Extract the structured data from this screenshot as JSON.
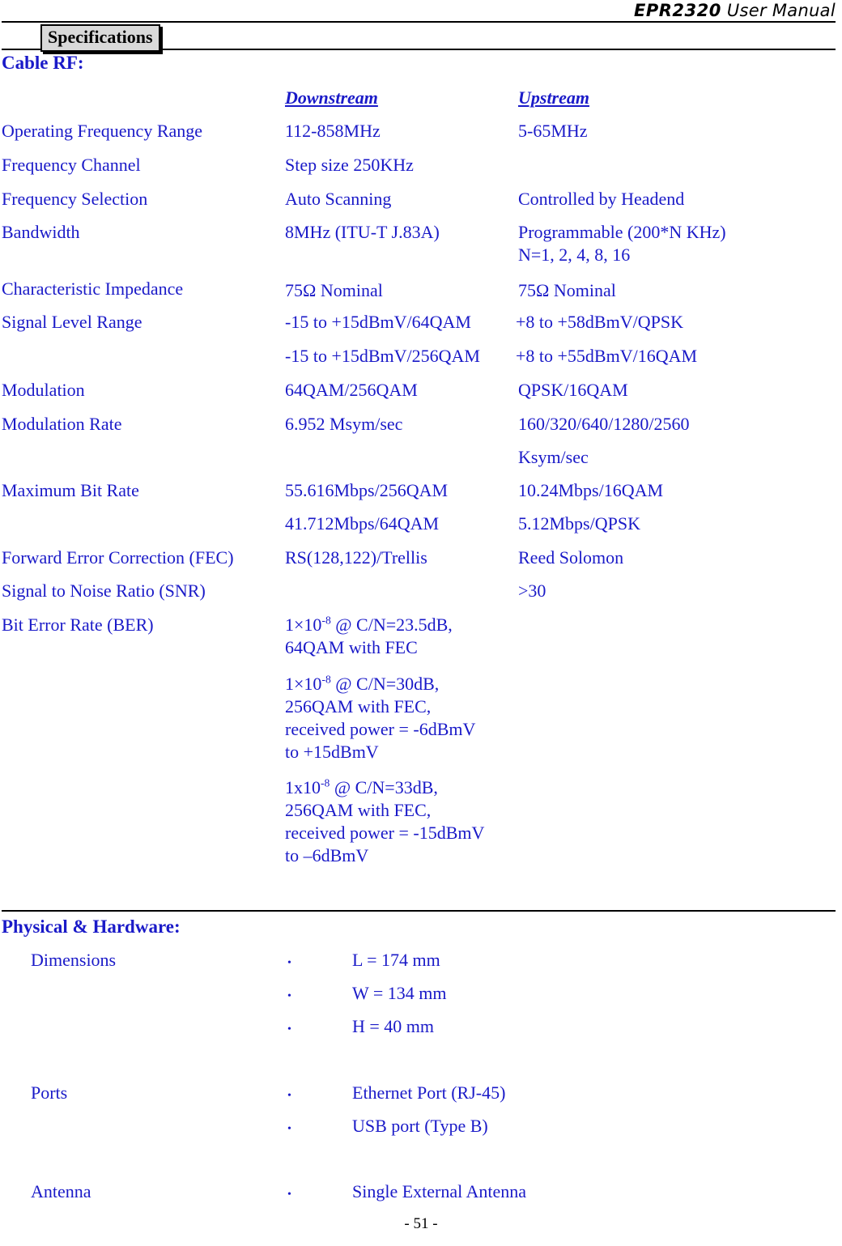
{
  "header": {
    "model": "EPR2320",
    "subtitle": " User Manual"
  },
  "section_chip": {
    "label": "Specifications"
  },
  "colors": {
    "body_blue": "#1a1aC8",
    "chip_bg": "#d9d9d9",
    "rule": "#000000",
    "footer_text": "#000000"
  },
  "sections": {
    "cable_rf": {
      "heading": "Cable RF:",
      "column_headers": {
        "downstream": "Downstream",
        "upstream": "Upstream"
      },
      "rows": [
        {
          "label": "Operating Frequency Range",
          "downstream": "112-858MHz",
          "upstream": "5-65MHz"
        },
        {
          "label": "Frequency Channel",
          "downstream": "Step size 250KHz",
          "upstream": ""
        },
        {
          "label": "Frequency Selection",
          "downstream": "Auto Scanning",
          "upstream": "Controlled by Headend"
        },
        {
          "label": "Bandwidth",
          "downstream": "8MHz (ITU-T J.83A)",
          "upstream": "Programmable (200*N KHz)\nN=1, 2, 4, 8, 16"
        },
        {
          "label": "Characteristic Impedance",
          "downstream": "75Ω Nominal",
          "upstream": "75Ω Nominal"
        },
        {
          "label": "Signal Level Range",
          "downstream": "-15 to +15dBmV/64QAM",
          "upstream": "+8 to +58dBmV/QPSK"
        },
        {
          "label": "",
          "downstream": "-15 to +15dBmV/256QAM",
          "upstream": "+8 to +55dBmV/16QAM"
        },
        {
          "label": "Modulation",
          "downstream": "64QAM/256QAM",
          "upstream": "QPSK/16QAM"
        },
        {
          "label": "Modulation Rate",
          "downstream": "6.952 Msym/sec",
          "upstream": "160/320/640/1280/2560"
        },
        {
          "label": "",
          "downstream": "",
          "upstream": "Ksym/sec"
        },
        {
          "label": "Maximum Bit Rate",
          "downstream": "55.616Mbps/256QAM",
          "upstream": "10.24Mbps/16QAM"
        },
        {
          "label": "",
          "downstream": "41.712Mbps/64QAM",
          "upstream": "5.12Mbps/QPSK"
        },
        {
          "label": "Forward Error Correction (FEC)",
          "downstream": "RS(128,122)/Trellis",
          "upstream": "Reed Solomon"
        },
        {
          "label": "Signal to Noise Ratio (SNR)",
          "downstream": "",
          "upstream": ">30"
        },
        {
          "label": "Bit Error Rate (BER)",
          "downstream": "",
          "upstream": ""
        }
      ],
      "ber_blocks": [
        {
          "prefix": "1×10",
          "exponent": "-8",
          "rest": " @ C/N=23.5dB,\n64QAM with FEC"
        },
        {
          "prefix": "1×10",
          "exponent": "-8",
          "rest": " @ C/N=30dB,\n256QAM with FEC,\nreceived power = -6dBmV\nto +15dBmV"
        },
        {
          "prefix": "1x10",
          "exponent": "-8",
          "rest": " @ C/N=33dB,\n256QAM with FEC,\nreceived power = -15dBmV\nto –6dBmV"
        }
      ]
    },
    "physical_hardware": {
      "heading": "Physical & Hardware:",
      "groups": [
        {
          "label": "Dimensions",
          "items": [
            "L = 174 mm",
            "W = 134 mm",
            "H = 40 mm"
          ]
        },
        {
          "label": "Ports",
          "items": [
            "Ethernet Port (RJ-45)",
            "USB port (Type B)"
          ]
        },
        {
          "label": "Antenna",
          "items": [
            "Single External Antenna"
          ]
        }
      ]
    }
  },
  "footer": {
    "page_number": "- 51 -"
  }
}
